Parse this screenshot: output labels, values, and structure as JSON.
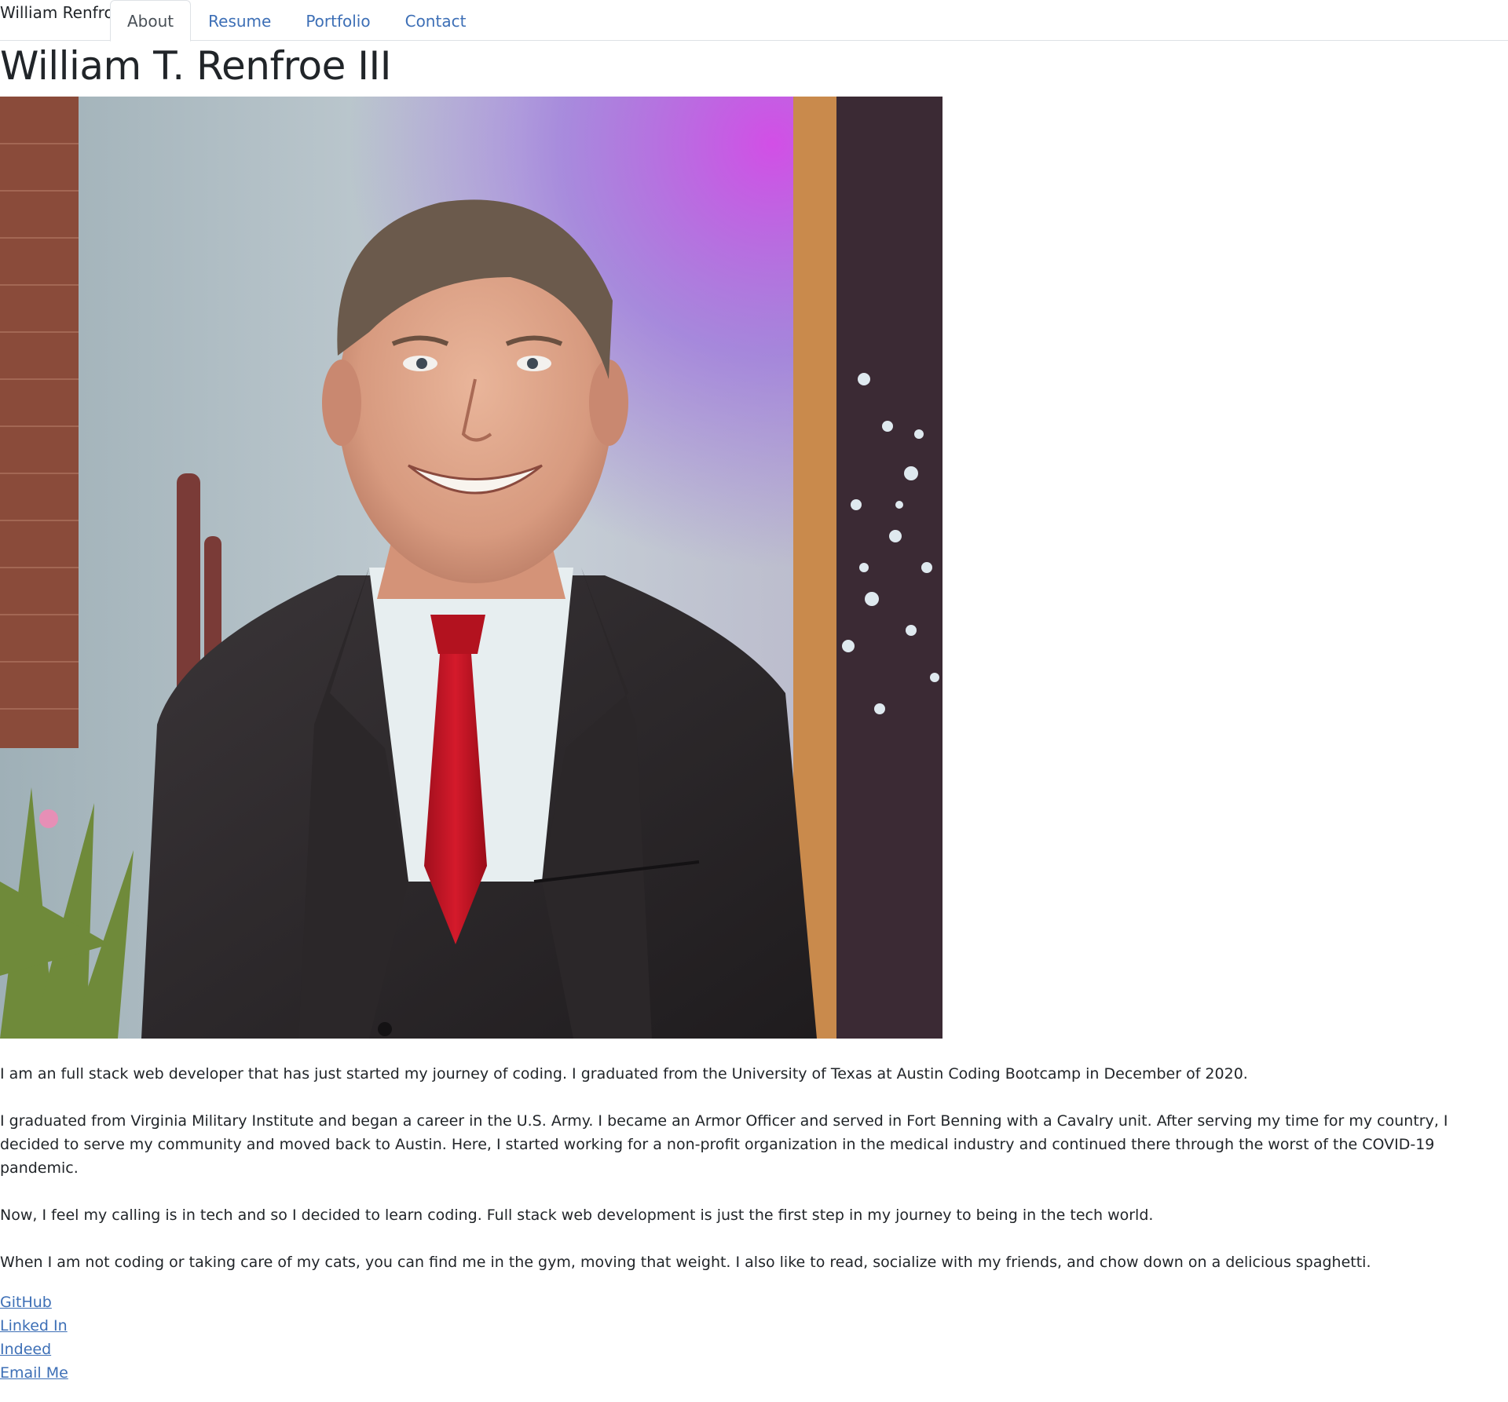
{
  "nav": {
    "brand": "William Renfroe",
    "tabs": [
      {
        "label": "About",
        "active": true
      },
      {
        "label": "Resume",
        "active": false
      },
      {
        "label": "Portfolio",
        "active": false
      },
      {
        "label": "Contact",
        "active": false
      }
    ]
  },
  "header": {
    "title": "William T. Renfroe III"
  },
  "bio": {
    "paragraphs": [
      "I am an full stack web developer that has just started my journey of coding. I graduated from the University of Texas at Austin Coding Bootcamp in December of 2020.",
      "I graduated from Virginia Military Institute and began a career in the U.S. Army. I became an Armor Officer and served in Fort Benning with a Cavalry unit. After serving my time for my country, I decided to serve my community and moved back to Austin. Here, I started working for a non-profit organization in the medical industry and continued there through the worst of the COVID-19 pandemic.",
      "Now, I feel my calling is in tech and so I decided to learn coding. Full stack web development is just the first step in my journey to being in the tech world.",
      "When I am not coding or taking care of my cats, you can find me in the gym, moving that weight. I also like to read, socialize with my friends, and chow down on a delicious spaghetti."
    ]
  },
  "links": [
    {
      "label": "GitHub"
    },
    {
      "label": "Linked In"
    },
    {
      "label": "Indeed"
    },
    {
      "label": "Email Me"
    }
  ],
  "colors": {
    "link": "#3d6fb6",
    "text": "#212529",
    "tab_border": "#dee2e6"
  }
}
